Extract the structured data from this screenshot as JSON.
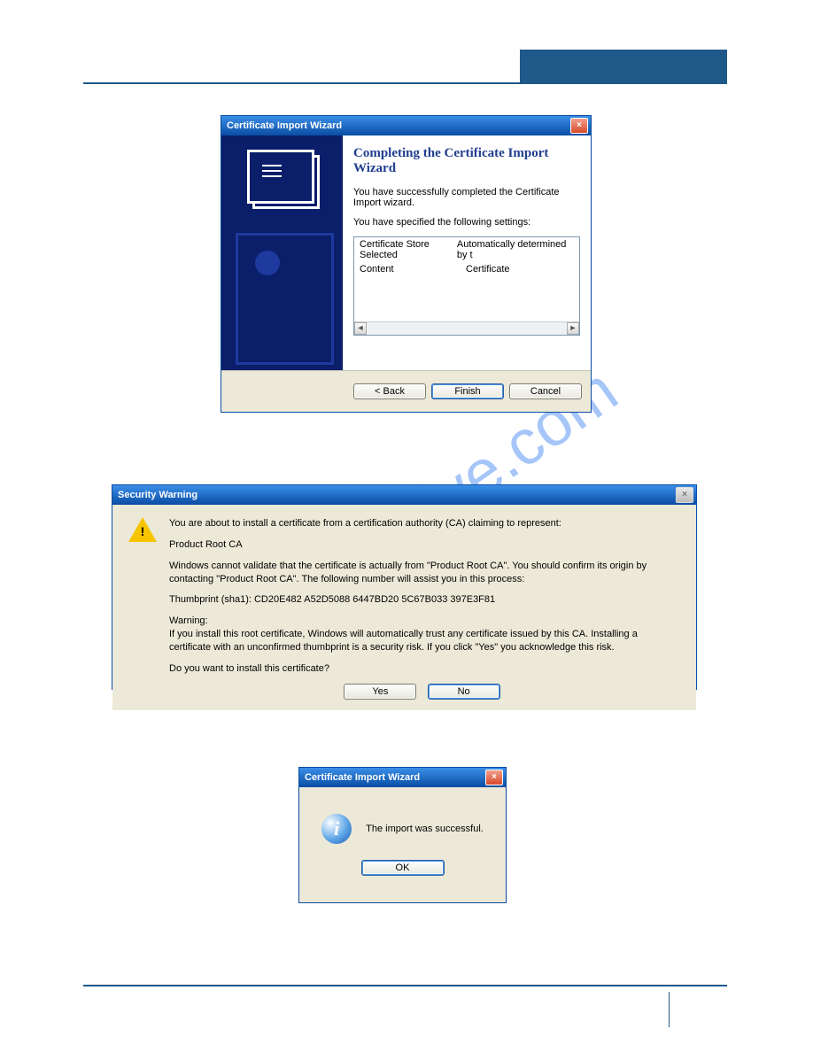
{
  "watermark": "manualshive.com",
  "wizard": {
    "title": "Certificate Import Wizard",
    "heading": "Completing the Certificate Import Wizard",
    "line1": "You have successfully completed the Certificate Import wizard.",
    "line2": "You have specified the following settings:",
    "rows": [
      {
        "k": "Certificate Store Selected",
        "v": "Automatically determined by t"
      },
      {
        "k": "Content",
        "v": "Certificate"
      }
    ],
    "back": "< Back",
    "finish": "Finish",
    "cancel": "Cancel"
  },
  "security": {
    "title": "Security Warning",
    "p1": "You are about to install a certificate from a certification authority (CA) claiming to represent:",
    "p2": "Product Root CA",
    "p3": "Windows cannot validate that the certificate is actually from \"Product Root CA\". You should confirm its origin by contacting \"Product Root CA\". The following number will assist you in this process:",
    "p4": "Thumbprint (sha1): CD20E482 A52D5088 6447BD20 5C67B033 397E3F81",
    "p5a": "Warning:",
    "p5b": "If you install this root certificate, Windows will automatically trust any certificate issued by this CA. Installing a certificate with an unconfirmed thumbprint is a security risk. If you click \"Yes\" you acknowledge this risk.",
    "p6": "Do you want to install this certificate?",
    "yes": "Yes",
    "no": "No"
  },
  "info": {
    "title": "Certificate Import Wizard",
    "msg": "The import was successful.",
    "ok": "OK"
  }
}
